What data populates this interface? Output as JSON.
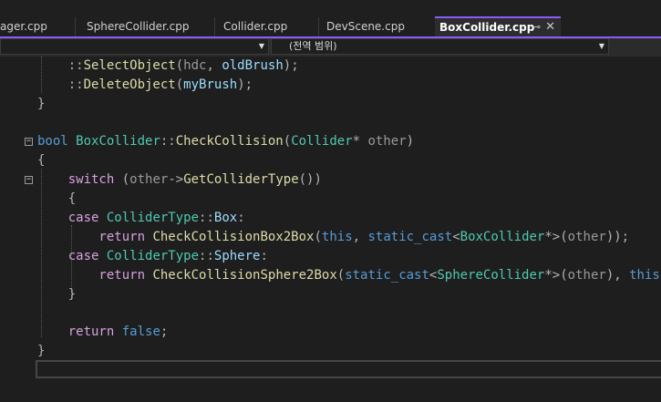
{
  "tabs": [
    {
      "label": "ager.cpp"
    },
    {
      "label": "SphereCollider.cpp"
    },
    {
      "label": "Collider.cpp"
    },
    {
      "label": "DevScene.cpp"
    },
    {
      "label": "BoxCollider.cpp",
      "active": true,
      "pin_icon": "pin-icon",
      "close_icon": "close-icon"
    }
  ],
  "nav": {
    "scope_label": "(전역 범위)",
    "dropdown_icon": "chevron-down-icon"
  },
  "code_lines": [
    "    ::SelectObject(hdc, oldBrush);",
    "    ::DeleteObject(myBrush);",
    "}",
    "",
    "bool BoxCollider::CheckCollision(Collider* other)",
    "{",
    "    switch (other->GetColliderType())",
    "    {",
    "    case ColliderType::Box:",
    "        return CheckCollisionBox2Box(this, static_cast<BoxCollider*>(other));",
    "    case ColliderType::Sphere:",
    "        return CheckCollisionSphere2Box(static_cast<SphereCollider*>(other), this",
    "    }",
    "",
    "    return false;",
    "}",
    ""
  ],
  "colors": {
    "accent": "#8b5cf6",
    "editor_bg": "#1e1e1e",
    "keyword": "#569cd6",
    "control": "#d8a0df",
    "type": "#4ec9b0",
    "function": "#dcdcaa",
    "param": "#9a9a9a",
    "variable": "#9cdcfe"
  }
}
